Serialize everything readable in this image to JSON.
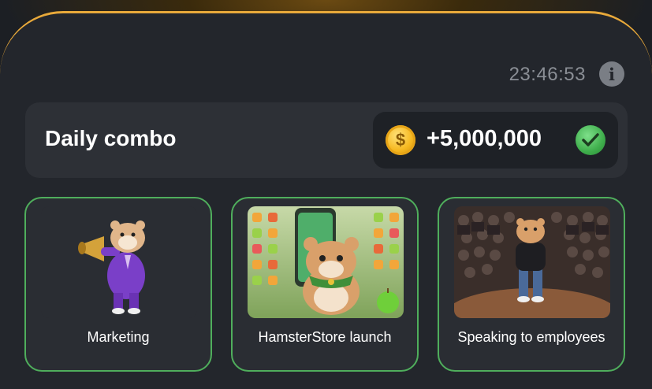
{
  "header": {
    "timer": "23:46:53",
    "info_icon": "info-icon"
  },
  "combo": {
    "title": "Daily combo",
    "reward": "+5,000,000",
    "coin_symbol": "$",
    "status_icon": "check-icon"
  },
  "cards": [
    {
      "label": "Marketing",
      "image": "hamster-marketing-image"
    },
    {
      "label": "HamsterStore launch",
      "image": "hamster-store-image"
    },
    {
      "label": "Speaking to employees",
      "image": "hamster-speaking-image"
    }
  ],
  "colors": {
    "accent_gold": "#e8a93a",
    "card_border_green": "#4fae5c",
    "check_green": "#3fae4c"
  }
}
